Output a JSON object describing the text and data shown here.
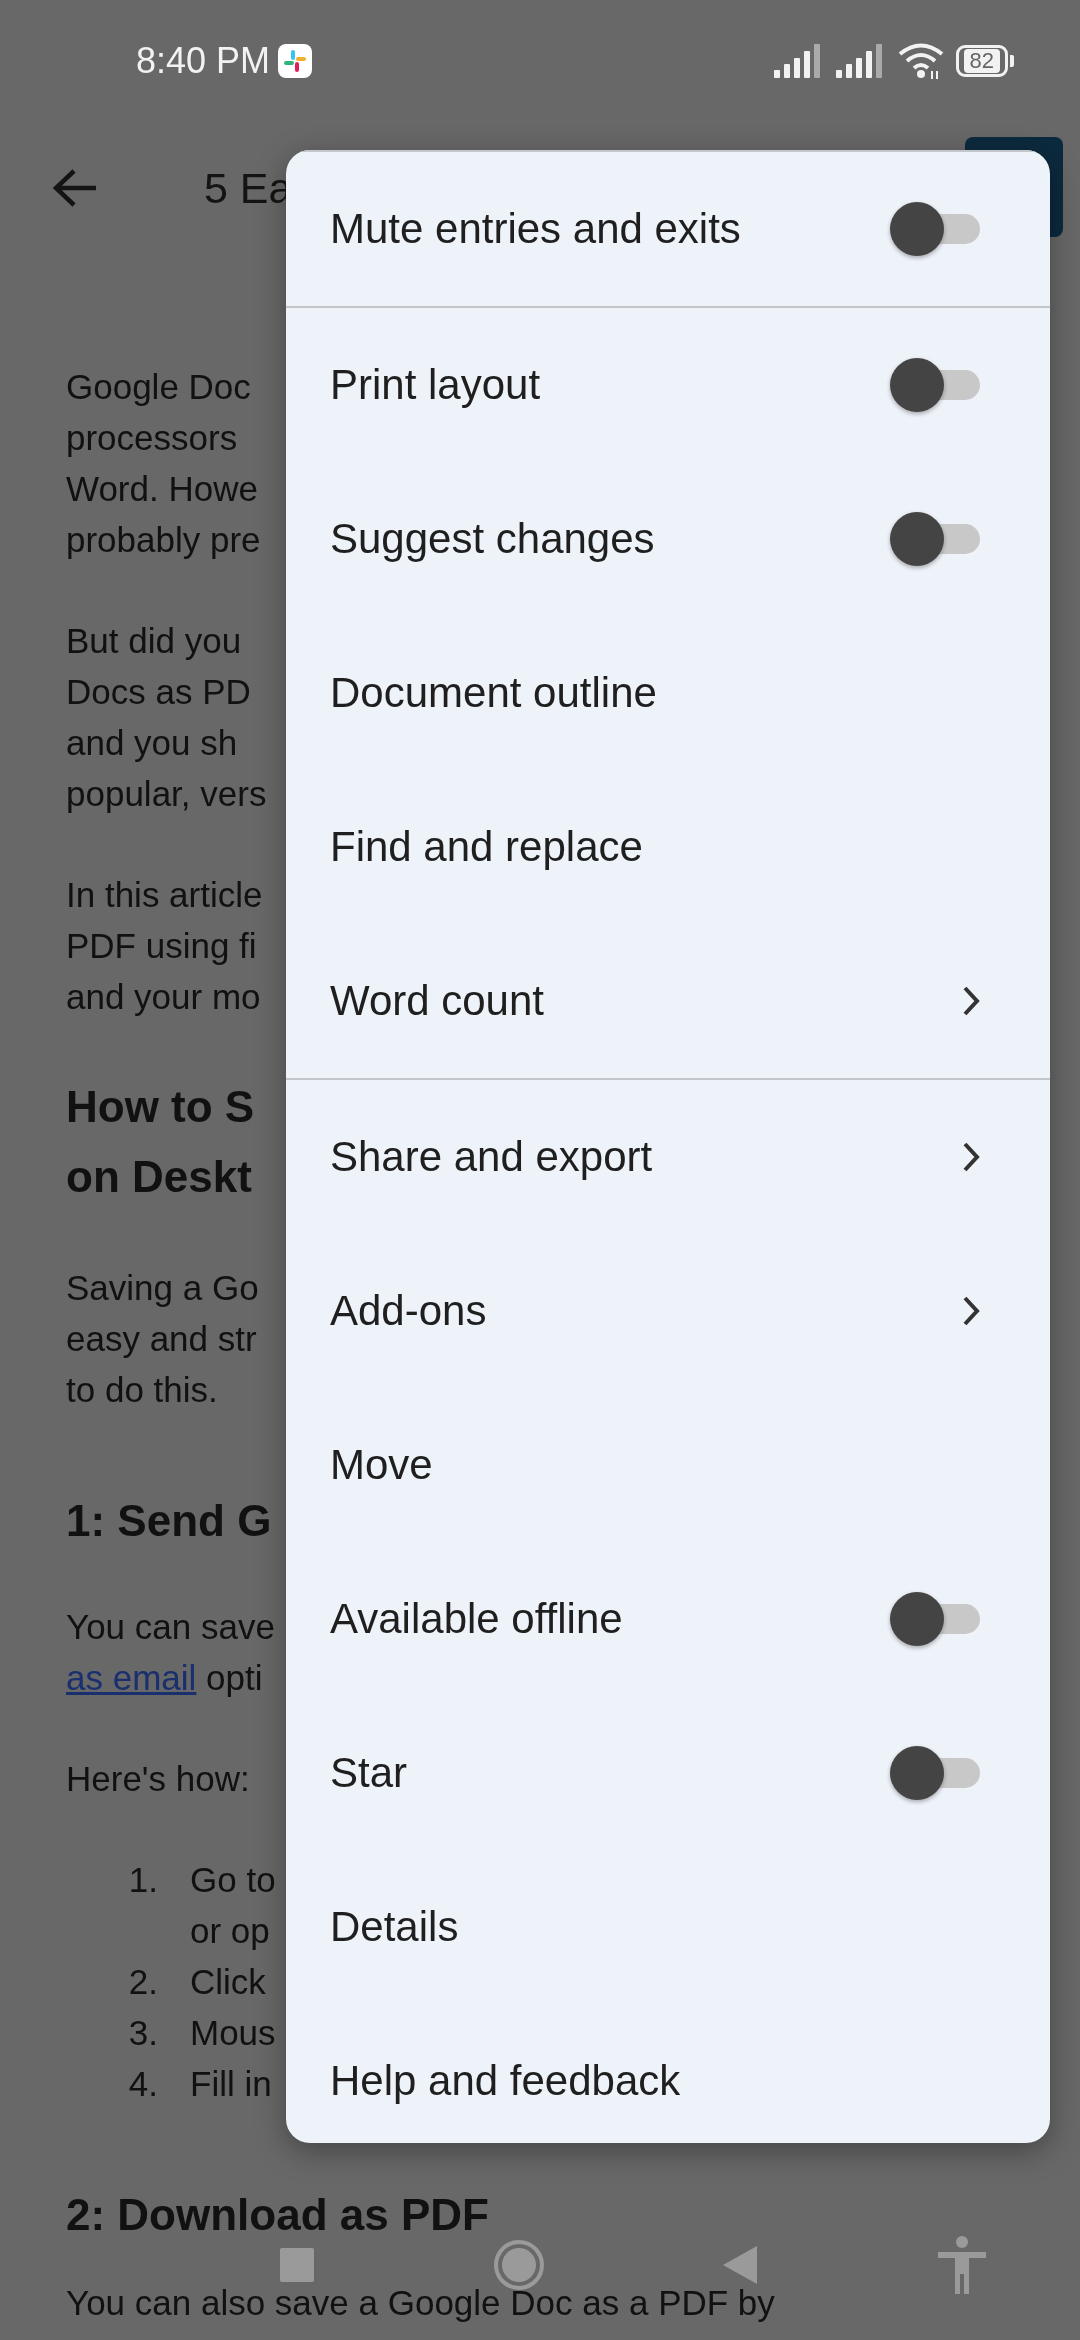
{
  "status_bar": {
    "time": "8:40 PM",
    "battery": "82"
  },
  "toolbar": {
    "title": "5 Ea"
  },
  "document": {
    "blocks": [
      {
        "kind": "paragraph",
        "lines": [
          "Google Doc",
          "processors",
          "Word. Howe",
          "probably pre"
        ]
      },
      {
        "kind": "paragraph",
        "lines": [
          "But did you",
          "Docs as PD",
          "and you sh",
          "popular, vers"
        ]
      },
      {
        "kind": "paragraph",
        "lines": [
          "In this article",
          "PDF using fi",
          "and your mo"
        ]
      },
      {
        "kind": "heading",
        "lines": [
          "How to S",
          "on Deskt"
        ]
      },
      {
        "kind": "paragraph",
        "lines": [
          "Saving a Go",
          "easy and str",
          "to do this."
        ]
      },
      {
        "kind": "subheading",
        "lines": [
          "1: Send G"
        ]
      },
      {
        "kind": "paragraph",
        "lines": [
          "You can save",
          {
            "link": "as email",
            "text": " opti"
          }
        ]
      },
      {
        "kind": "paragraph",
        "lines": [
          "Here's how:"
        ]
      },
      {
        "kind": "list",
        "items": [
          {
            "number": "1.",
            "lines": [
              "Go to",
              "or op"
            ]
          },
          {
            "number": "2.",
            "lines": [
              "Click"
            ]
          },
          {
            "number": "3.",
            "lines": [
              "Mous"
            ]
          },
          {
            "number": "4.",
            "lines": [
              "Fill in"
            ]
          }
        ]
      },
      {
        "kind": "subheading",
        "lines": [
          "2: Download as PDF"
        ]
      },
      {
        "kind": "paragraph",
        "lines": [
          "You can also save a Google Doc as a PDF by"
        ]
      }
    ]
  },
  "menu": {
    "sections": [
      [
        {
          "kind": "toggle",
          "label": "Mute entries and exits",
          "on": false
        }
      ],
      [
        {
          "kind": "toggle",
          "label": "Print layout",
          "on": false
        },
        {
          "kind": "toggle",
          "label": "Suggest changes",
          "on": false
        },
        {
          "kind": "plain",
          "label": "Document outline"
        },
        {
          "kind": "plain",
          "label": "Find and replace"
        },
        {
          "kind": "submenu",
          "label": "Word count"
        }
      ],
      [
        {
          "kind": "submenu",
          "label": "Share and export"
        },
        {
          "kind": "submenu",
          "label": "Add-ons"
        },
        {
          "kind": "plain",
          "label": "Move"
        },
        {
          "kind": "toggle",
          "label": "Available offline",
          "on": false
        },
        {
          "kind": "toggle",
          "label": "Star",
          "on": false
        },
        {
          "kind": "plain",
          "label": "Details"
        },
        {
          "kind": "plain",
          "label": "Help and feedback"
        }
      ]
    ]
  }
}
